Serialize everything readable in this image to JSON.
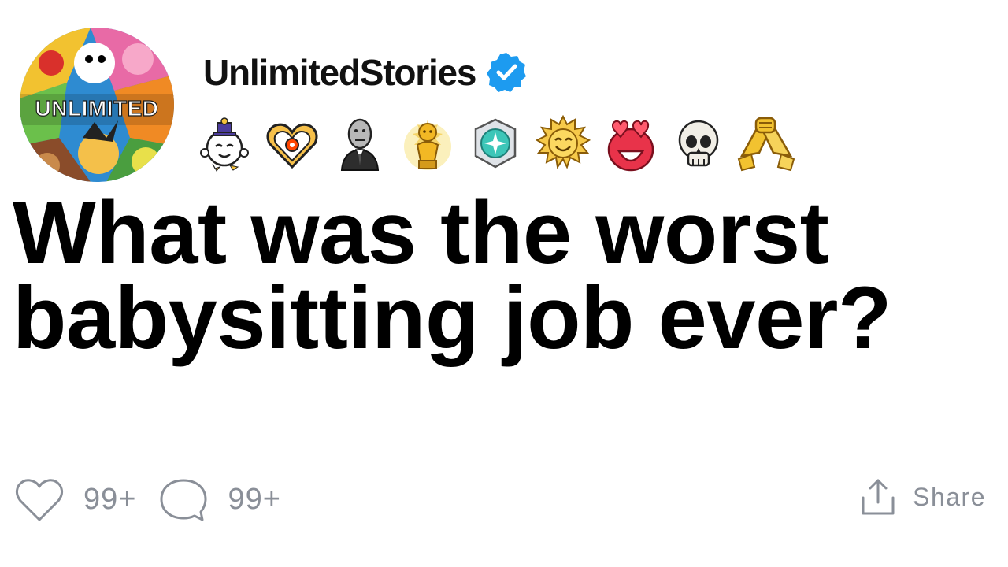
{
  "profile": {
    "avatar_text": "UNLIMITED",
    "username": "UnlimitedStories",
    "verified_icon": "verified-badge-icon"
  },
  "awards": [
    {
      "icon": "wholesome-award-icon"
    },
    {
      "icon": "heartwarming-award-icon"
    },
    {
      "icon": "stonks-award-icon"
    },
    {
      "icon": "gold-award-icon"
    },
    {
      "icon": "platinum-award-icon"
    },
    {
      "icon": "sunny-award-icon"
    },
    {
      "icon": "love-eyes-award-icon"
    },
    {
      "icon": "skull-award-icon"
    },
    {
      "icon": "handshake-award-icon"
    }
  ],
  "post": {
    "title": "What was the worst babysitting job ever?"
  },
  "actions": {
    "likes_count": "99+",
    "comments_count": "99+",
    "share_label": "Share"
  },
  "colors": {
    "verified": "#1d9bf0",
    "muted_text": "#8a8f98",
    "title": "#000000"
  }
}
